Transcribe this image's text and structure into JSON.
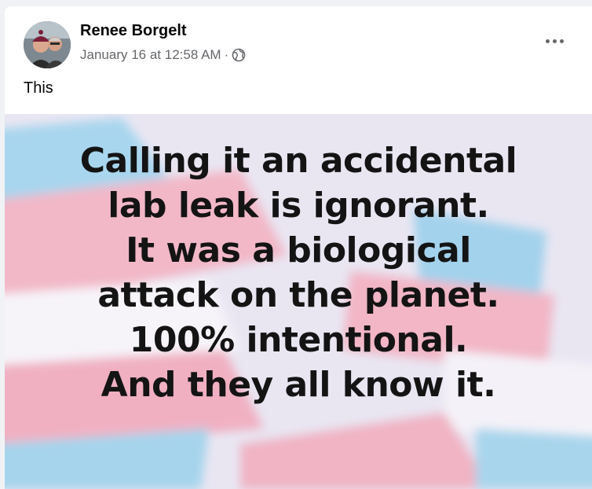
{
  "post": {
    "author": "Renee Borgelt",
    "timestamp": "January 16 at 12:58 AM",
    "separator": "·",
    "privacy_icon": "globe-icon",
    "menu_icon": "more-options-icon",
    "caption": "This",
    "image": {
      "lines": [
        "Calling it an accidental",
        "lab leak is ignorant.",
        "It was a biological",
        "attack on the planet.",
        "100% intentional.",
        "And they all know it."
      ]
    }
  },
  "colors": {
    "card_background": "#ffffff",
    "secondary_text": "#65676b",
    "flag_blue": "#9fd3ee",
    "flag_pink": "#f0b3c4",
    "flag_white": "#f7f5fa"
  }
}
